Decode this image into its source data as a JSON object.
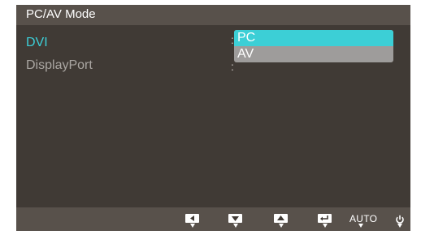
{
  "title": "PC/AV Mode",
  "menu": {
    "items": [
      {
        "label": "DVI",
        "colon": ":"
      },
      {
        "label": "DisplayPort",
        "colon": ":"
      }
    ]
  },
  "dropdown": {
    "options": [
      "PC",
      "AV"
    ],
    "selected": "PC"
  },
  "bottom_bar": {
    "auto_label": "AUTO",
    "buttons": [
      "left-arrow-icon",
      "down-arrow-icon",
      "up-arrow-icon",
      "enter-icon",
      "auto",
      "power-icon"
    ]
  },
  "colors": {
    "accent": "#3ccfd8",
    "background": "#403a35",
    "bar": "#58514b",
    "dropdown": "#9e9c9b"
  }
}
